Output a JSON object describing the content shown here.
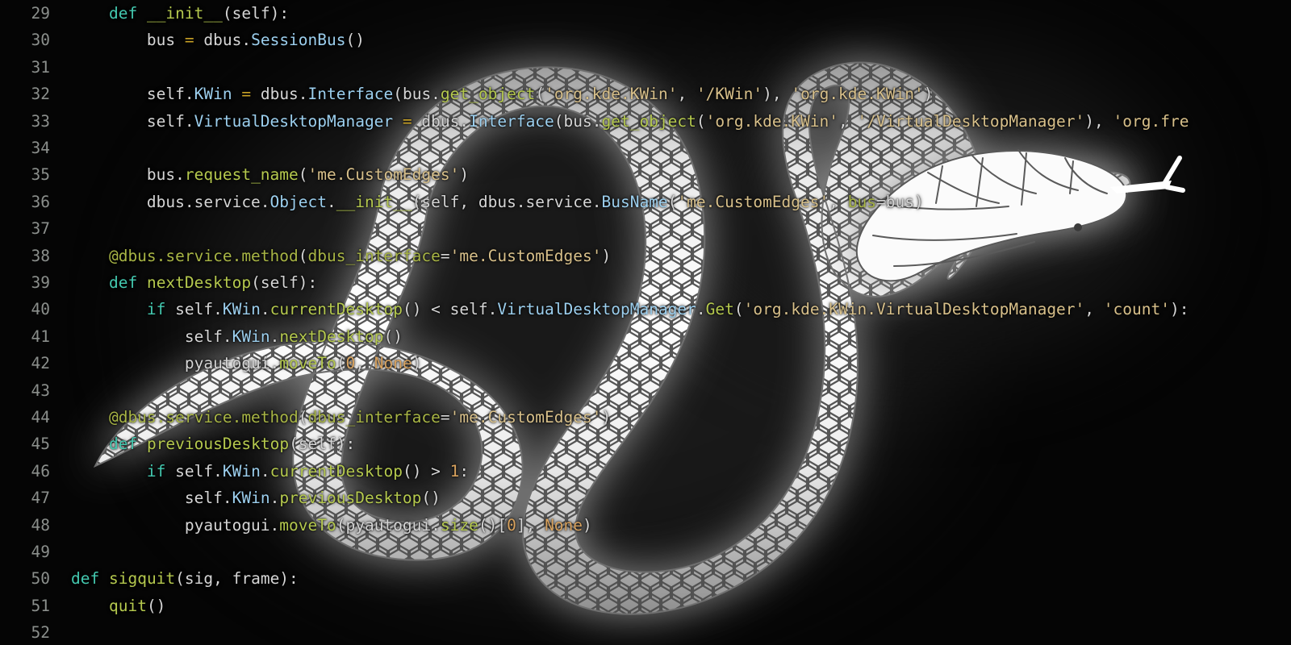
{
  "editor": {
    "app": "code-editor",
    "language": "Python",
    "background_color": "#050505",
    "line_number_color": "#8b8f8c",
    "default_text_color": "#d6d6d6",
    "font_size_px": 19.5,
    "line_height_px": 33.4,
    "first_visible_line": 29,
    "last_visible_line": 52,
    "palette": {
      "keyword": "#44c9b0",
      "function": "#b5c94e",
      "attribute": "#9ccfee",
      "string": "#d8c08a",
      "number": "#d8a25e",
      "operator": "#c9a227",
      "decorator": "#a8b545",
      "plain": "#d6d6d6"
    }
  },
  "wallpaper": {
    "name": "snake-illustration",
    "description": "Large white scaled snake coiled in an S-shape with forked tongue, glowing over a black background",
    "body_color": "#ffffff",
    "scale_line_color": "#4a4a4a",
    "glow_color": "#3a3a3a"
  },
  "lines": [
    {
      "number": "29",
      "tokens": [
        {
          "t": "    ",
          "c": "plain"
        },
        {
          "t": "def",
          "c": "kw"
        },
        {
          "t": " ",
          "c": "plain"
        },
        {
          "t": "__init__",
          "c": "fn"
        },
        {
          "t": "(self):",
          "c": "plain"
        }
      ]
    },
    {
      "number": "30",
      "tokens": [
        {
          "t": "        bus ",
          "c": "plain"
        },
        {
          "t": "=",
          "c": "op"
        },
        {
          "t": " dbus.",
          "c": "plain"
        },
        {
          "t": "SessionBus",
          "c": "attr"
        },
        {
          "t": "()",
          "c": "plain"
        }
      ]
    },
    {
      "number": "31",
      "tokens": []
    },
    {
      "number": "32",
      "tokens": [
        {
          "t": "        self.",
          "c": "plain"
        },
        {
          "t": "KWin",
          "c": "attr"
        },
        {
          "t": " ",
          "c": "plain"
        },
        {
          "t": "=",
          "c": "op"
        },
        {
          "t": " dbus.",
          "c": "plain"
        },
        {
          "t": "Interface",
          "c": "attr"
        },
        {
          "t": "(bus.",
          "c": "plain"
        },
        {
          "t": "get_object",
          "c": "fn"
        },
        {
          "t": "(",
          "c": "plain"
        },
        {
          "t": "'org.kde.KWin'",
          "c": "str"
        },
        {
          "t": ", ",
          "c": "plain"
        },
        {
          "t": "'/KWin'",
          "c": "str"
        },
        {
          "t": "), ",
          "c": "plain"
        },
        {
          "t": "'org.kde.KWin'",
          "c": "str"
        },
        {
          "t": ")",
          "c": "plain"
        }
      ]
    },
    {
      "number": "33",
      "tokens": [
        {
          "t": "        self.",
          "c": "plain"
        },
        {
          "t": "VirtualDesktopManager",
          "c": "attr"
        },
        {
          "t": " ",
          "c": "plain"
        },
        {
          "t": "=",
          "c": "op"
        },
        {
          "t": " dbus.",
          "c": "plain"
        },
        {
          "t": "Interface",
          "c": "attr"
        },
        {
          "t": "(bus.",
          "c": "plain"
        },
        {
          "t": "get_object",
          "c": "fn"
        },
        {
          "t": "(",
          "c": "plain"
        },
        {
          "t": "'org.kde.KWin'",
          "c": "str"
        },
        {
          "t": ", ",
          "c": "plain"
        },
        {
          "t": "'/VirtualDesktopManager'",
          "c": "str"
        },
        {
          "t": "), ",
          "c": "plain"
        },
        {
          "t": "'org.fre",
          "c": "str"
        }
      ]
    },
    {
      "number": "34",
      "tokens": []
    },
    {
      "number": "35",
      "tokens": [
        {
          "t": "        bus.",
          "c": "plain"
        },
        {
          "t": "request_name",
          "c": "fn"
        },
        {
          "t": "(",
          "c": "plain"
        },
        {
          "t": "'me.CustomEdges'",
          "c": "str"
        },
        {
          "t": ")",
          "c": "plain"
        }
      ]
    },
    {
      "number": "36",
      "tokens": [
        {
          "t": "        dbus.service.",
          "c": "plain"
        },
        {
          "t": "Object",
          "c": "attr"
        },
        {
          "t": ".",
          "c": "plain"
        },
        {
          "t": "__init__",
          "c": "fn"
        },
        {
          "t": "(self, dbus.service.",
          "c": "plain"
        },
        {
          "t": "BusName",
          "c": "attr"
        },
        {
          "t": "(",
          "c": "plain"
        },
        {
          "t": "'me.CustomEdges'",
          "c": "str"
        },
        {
          "t": ", ",
          "c": "plain"
        },
        {
          "t": "bus",
          "c": "kwarg"
        },
        {
          "t": "=bus)",
          "c": "plain"
        }
      ]
    },
    {
      "number": "37",
      "tokens": []
    },
    {
      "number": "38",
      "tokens": [
        {
          "t": "    @dbus.service.method",
          "c": "dec"
        },
        {
          "t": "(",
          "c": "plain"
        },
        {
          "t": "dbus_interface",
          "c": "kwarg"
        },
        {
          "t": "=",
          "c": "plain"
        },
        {
          "t": "'me.CustomEdges'",
          "c": "str"
        },
        {
          "t": ")",
          "c": "plain"
        }
      ]
    },
    {
      "number": "39",
      "tokens": [
        {
          "t": "    ",
          "c": "plain"
        },
        {
          "t": "def",
          "c": "kw"
        },
        {
          "t": " ",
          "c": "plain"
        },
        {
          "t": "nextDesktop",
          "c": "fn"
        },
        {
          "t": "(self):",
          "c": "plain"
        }
      ]
    },
    {
      "number": "40",
      "tokens": [
        {
          "t": "        ",
          "c": "plain"
        },
        {
          "t": "if",
          "c": "kw"
        },
        {
          "t": " self.",
          "c": "plain"
        },
        {
          "t": "KWin",
          "c": "attr"
        },
        {
          "t": ".",
          "c": "plain"
        },
        {
          "t": "currentDesktop",
          "c": "fn"
        },
        {
          "t": "() < self.",
          "c": "plain"
        },
        {
          "t": "VirtualDesktopManager",
          "c": "attr"
        },
        {
          "t": ".",
          "c": "plain"
        },
        {
          "t": "Get",
          "c": "fn"
        },
        {
          "t": "(",
          "c": "plain"
        },
        {
          "t": "'org.kde.KWin.VirtualDesktopManager'",
          "c": "str"
        },
        {
          "t": ", ",
          "c": "plain"
        },
        {
          "t": "'count'",
          "c": "str"
        },
        {
          "t": "):",
          "c": "plain"
        }
      ]
    },
    {
      "number": "41",
      "tokens": [
        {
          "t": "            self.",
          "c": "plain"
        },
        {
          "t": "KWin",
          "c": "attr"
        },
        {
          "t": ".",
          "c": "plain"
        },
        {
          "t": "nextDesktop",
          "c": "fn"
        },
        {
          "t": "()",
          "c": "plain"
        }
      ]
    },
    {
      "number": "42",
      "tokens": [
        {
          "t": "            pyautogui.",
          "c": "plain"
        },
        {
          "t": "moveTo",
          "c": "fn"
        },
        {
          "t": "(",
          "c": "plain"
        },
        {
          "t": "0",
          "c": "num"
        },
        {
          "t": ", ",
          "c": "plain"
        },
        {
          "t": "None",
          "c": "num"
        },
        {
          "t": ")",
          "c": "plain"
        }
      ]
    },
    {
      "number": "43",
      "tokens": []
    },
    {
      "number": "44",
      "tokens": [
        {
          "t": "    @dbus.service.method",
          "c": "dec"
        },
        {
          "t": "(",
          "c": "plain"
        },
        {
          "t": "dbus_interface",
          "c": "kwarg"
        },
        {
          "t": "=",
          "c": "plain"
        },
        {
          "t": "'me.CustomEdges'",
          "c": "str"
        },
        {
          "t": ")",
          "c": "plain"
        }
      ]
    },
    {
      "number": "45",
      "tokens": [
        {
          "t": "    ",
          "c": "plain"
        },
        {
          "t": "def",
          "c": "kw"
        },
        {
          "t": " ",
          "c": "plain"
        },
        {
          "t": "previousDesktop",
          "c": "fn"
        },
        {
          "t": "(self):",
          "c": "plain"
        }
      ]
    },
    {
      "number": "46",
      "tokens": [
        {
          "t": "        ",
          "c": "plain"
        },
        {
          "t": "if",
          "c": "kw"
        },
        {
          "t": " self.",
          "c": "plain"
        },
        {
          "t": "KWin",
          "c": "attr"
        },
        {
          "t": ".",
          "c": "plain"
        },
        {
          "t": "currentDesktop",
          "c": "fn"
        },
        {
          "t": "() > ",
          "c": "plain"
        },
        {
          "t": "1",
          "c": "num"
        },
        {
          "t": ":",
          "c": "plain"
        }
      ]
    },
    {
      "number": "47",
      "tokens": [
        {
          "t": "            self.",
          "c": "plain"
        },
        {
          "t": "KWin",
          "c": "attr"
        },
        {
          "t": ".",
          "c": "plain"
        },
        {
          "t": "previousDesktop",
          "c": "fn"
        },
        {
          "t": "()",
          "c": "plain"
        }
      ]
    },
    {
      "number": "48",
      "tokens": [
        {
          "t": "            pyautogui.",
          "c": "plain"
        },
        {
          "t": "moveTo",
          "c": "fn"
        },
        {
          "t": "(pyautogui.",
          "c": "plain"
        },
        {
          "t": "size",
          "c": "fn"
        },
        {
          "t": "()[",
          "c": "plain"
        },
        {
          "t": "0",
          "c": "num"
        },
        {
          "t": "], ",
          "c": "plain"
        },
        {
          "t": "None",
          "c": "num"
        },
        {
          "t": ")",
          "c": "plain"
        }
      ]
    },
    {
      "number": "49",
      "tokens": []
    },
    {
      "number": "50",
      "tokens": [
        {
          "t": "def",
          "c": "kw"
        },
        {
          "t": " ",
          "c": "plain"
        },
        {
          "t": "sigquit",
          "c": "fn"
        },
        {
          "t": "(sig, frame):",
          "c": "plain"
        }
      ]
    },
    {
      "number": "51",
      "tokens": [
        {
          "t": "    ",
          "c": "plain"
        },
        {
          "t": "quit",
          "c": "fn"
        },
        {
          "t": "()",
          "c": "plain"
        }
      ]
    },
    {
      "number": "52",
      "tokens": []
    }
  ]
}
